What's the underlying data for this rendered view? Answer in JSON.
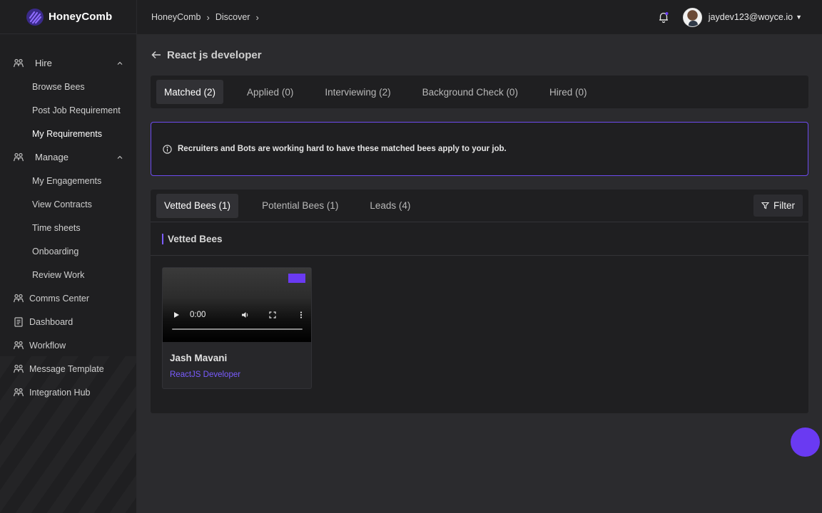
{
  "app": {
    "name": "HoneyComb"
  },
  "sidebar": {
    "groups": [
      {
        "label": "Hire",
        "items": [
          "Browse Bees",
          "Post Job Requirement",
          "My Requirements"
        ]
      },
      {
        "label": "Manage",
        "items": [
          "My Engagements",
          "View Contracts",
          "Time sheets",
          "Onboarding",
          "Review Work"
        ]
      }
    ],
    "items": [
      "Comms Center",
      "Dashboard",
      "Workflow",
      "Message Template",
      "Integration Hub"
    ]
  },
  "breadcrumb": [
    "HoneyComb",
    "Discover"
  ],
  "user": {
    "email": "jaydev123@woyce.io"
  },
  "page": {
    "title": "React js developer"
  },
  "status_tabs": [
    "Matched (2)",
    "Applied (0)",
    "Interviewing (2)",
    "Background Check (0)",
    "Hired (0)"
  ],
  "info": {
    "text": "Recruiters and Bots are working hard to have these matched bees apply to your job."
  },
  "bee_tabs": [
    "Vetted Bees (1)",
    "Potential Bees (1)",
    "Leads (4)"
  ],
  "filter_label": "Filter",
  "section": {
    "title": "Vetted Bees"
  },
  "bee": {
    "name": "Jash Mavani",
    "role": "ReactJS Developer",
    "video_time": "0:00"
  },
  "colors": {
    "accent": "#6a3af2",
    "role": "#7a5cff"
  }
}
